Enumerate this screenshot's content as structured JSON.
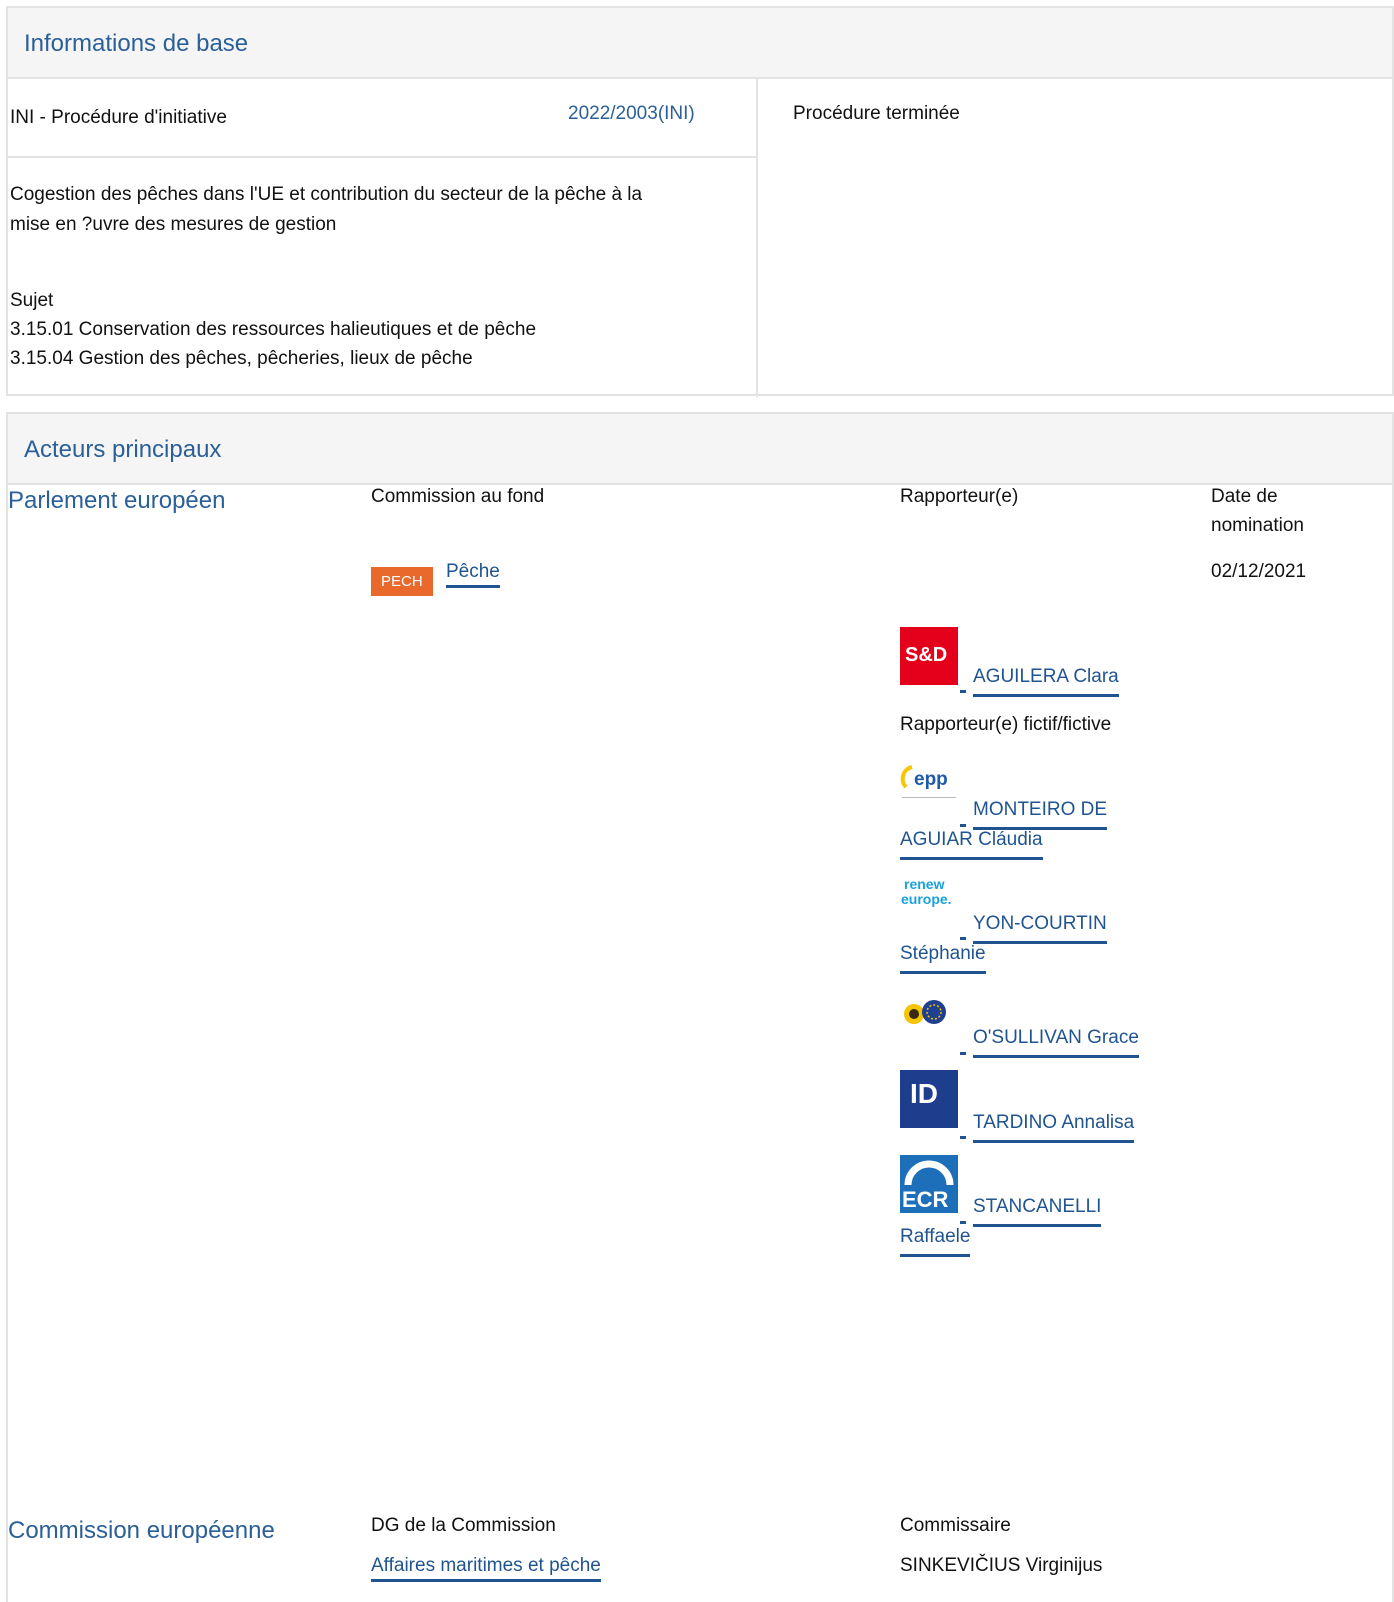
{
  "basic": {
    "title": "Informations de base",
    "procedure_type": "INI - Procédure d'initiative",
    "procedure_ref": "2022/2003(INI)",
    "status": "Procédure terminée",
    "description_line1": "Cogestion des pêches dans l'UE et contribution du secteur de la pêche à la",
    "description_line2": "mise en ?uvre des mesures de gestion",
    "subject_label": "Sujet",
    "subjects": [
      "3.15.01 Conservation des ressources halieutiques et de pêche",
      "3.15.04 Gestion des pêches, pêcheries, lieux de pêche"
    ]
  },
  "actors": {
    "title": "Acteurs principaux",
    "parliament": {
      "label": "Parlement européen",
      "col_committee": "Commission au fond",
      "col_rapporteur": "Rapporteur(e)",
      "col_date_line1": "Date de",
      "col_date_line2": "nomination",
      "committee_badge": "PECH",
      "committee_name": "Pêche",
      "date": "02/12/2021",
      "rapporteur": {
        "name": "AGUILERA Clara",
        "group_icon": "sd-group-logo",
        "logo_text": "S&D"
      },
      "shadow_label": "Rapporteur(e) fictif/fictive",
      "shadows": [
        {
          "name_line1": "MONTEIRO DE",
          "name_line2": "AGUIAR Cláudia",
          "group_icon": "epp-group-logo",
          "logo_text": "epp"
        },
        {
          "name_line1": "YON-COURTIN",
          "name_line2": "Stéphanie",
          "group_icon": "renew-europe-logo",
          "logo_text1": "renew",
          "logo_text2": "europe."
        },
        {
          "name_line1": "O'SULLIVAN Grace",
          "group_icon": "greens-efa-logo"
        },
        {
          "name_line1": "TARDINO Annalisa",
          "group_icon": "id-group-logo",
          "logo_text": "ID"
        },
        {
          "name_line1": "STANCANELLI",
          "name_line2": "Raffaele",
          "group_icon": "ecr-group-logo",
          "logo_text": "ECR"
        }
      ]
    },
    "commission": {
      "label": "Commission européenne",
      "col_dg": "DG de la Commission",
      "col_commissioner": "Commissaire",
      "dg": "Affaires maritimes et pêche",
      "commissioner": "SINKEVIČIUS Virginijus"
    }
  }
}
